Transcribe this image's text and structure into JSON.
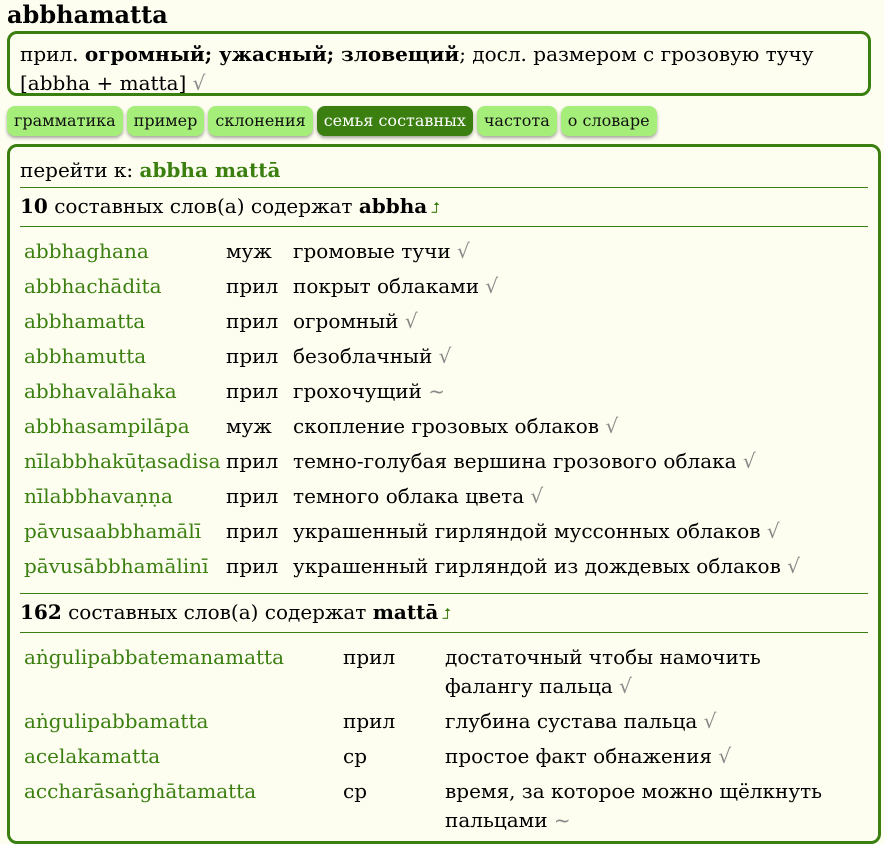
{
  "headword": "abbhamatta",
  "summary": {
    "pos": "прил.",
    "meaning_bold": "огромный; ужасный; зловещий",
    "literal": "; досл. размером с грозовую тучу",
    "construction": "[abbha + matta]",
    "check": "√"
  },
  "tabs": [
    "грамматика",
    "пример",
    "склонения",
    "семья составных",
    "частота",
    "о словаре"
  ],
  "active_tab": "семья составных",
  "jump": {
    "label": "перейти к:",
    "target": "abbha mattā"
  },
  "sections": [
    {
      "count": "10",
      "text": "составных слов(а) содержат",
      "word": "abbha",
      "arrow": "⮥",
      "rows": [
        {
          "word": "abbhaghana",
          "pos": "муж",
          "meaning": "громовые тучи",
          "mark": "√"
        },
        {
          "word": "abbhachādita",
          "pos": "прил",
          "meaning": "покрыт облаками",
          "mark": "√"
        },
        {
          "word": "abbhamatta",
          "pos": "прил",
          "meaning": "огромный",
          "mark": "√"
        },
        {
          "word": "abbhamutta",
          "pos": "прил",
          "meaning": "безоблачный",
          "mark": "√"
        },
        {
          "word": "abbhavalāhaka",
          "pos": "прил",
          "meaning": "грохочущий",
          "mark": "~"
        },
        {
          "word": "abbhasampilāpa",
          "pos": "муж",
          "meaning": "скопление грозовых облаков",
          "mark": "√"
        },
        {
          "word": "nīlabbhakūṭasadisa",
          "pos": "прил",
          "meaning": "темно-голубая вершина грозового облака",
          "mark": "√"
        },
        {
          "word": "nīlabbhavaṇṇa",
          "pos": "прил",
          "meaning": "темного облака цвета",
          "mark": "√"
        },
        {
          "word": "pāvusaabbhamālī",
          "pos": "прил",
          "meaning": "украшенный гирляндой муссонных облаков",
          "mark": "√"
        },
        {
          "word": "pāvusābbhamālinī",
          "pos": "прил",
          "meaning": "украшенный гирляндой из дождевых облаков",
          "mark": "√"
        }
      ]
    },
    {
      "count": "162",
      "text": "составных слов(а) содержат",
      "word": "mattā",
      "arrow": "⮥",
      "rows": [
        {
          "word": "aṅgulipabbatemanamatta",
          "pos": "прил",
          "meaning": "достаточный чтобы намочить фалангу пальца",
          "mark": "√"
        },
        {
          "word": "aṅgulipabbamatta",
          "pos": "прил",
          "meaning": "глубина сустава пальца",
          "mark": "√"
        },
        {
          "word": "acelakamatta",
          "pos": "ср",
          "meaning": "простое факт обнажения",
          "mark": "√"
        },
        {
          "word": "accharāsaṅghātamatta",
          "pos": "ср",
          "meaning": "время, за которое можно щёлкнуть пальцами",
          "mark": "~"
        }
      ]
    }
  ]
}
